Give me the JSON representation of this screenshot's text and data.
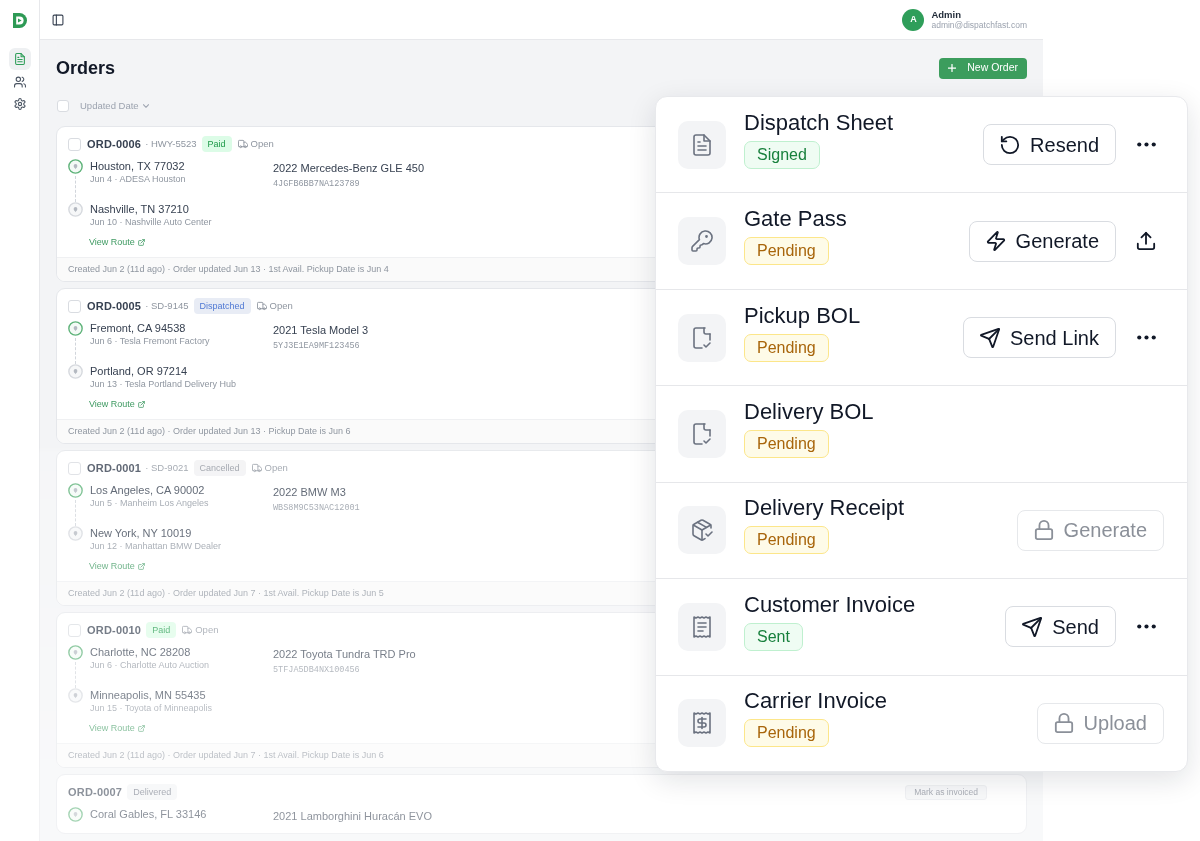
{
  "sidebar": {
    "nav": [
      {
        "kind": "orders",
        "selected": true
      },
      {
        "kind": "users",
        "selected": false
      },
      {
        "kind": "settings",
        "selected": false
      }
    ]
  },
  "header": {
    "user": {
      "initial": "A",
      "name": "Admin",
      "email": "admin@dispatchfast.com"
    }
  },
  "page": {
    "title": "Orders",
    "new_order_button": "New Order",
    "sort": {
      "checked": false,
      "label": "Updated Date"
    }
  },
  "orders": [
    {
      "number": "ORD-0006",
      "ref": "· HWY-5523",
      "checked": false,
      "status": {
        "label": "Paid",
        "kind": "paid"
      },
      "shipment": "Open",
      "stops": [
        {
          "kind": "pickup",
          "city": "Houston, TX 77032",
          "detail": "Jun 4 · ADESA Houston"
        },
        {
          "kind": "delivery",
          "city": "Nashville, TN 37210",
          "detail": "Jun 10 · Nashville Auto Center"
        }
      ],
      "vehicle": {
        "name": "2022 Mercedes-Benz GLE 450",
        "vin": "4JGFB6BB7NA123789"
      },
      "route_link": "View Route",
      "footer": "Created Jun 2 (11d ago) · Order updated Jun 13 · 1st Avail. Pickup Date is Jun 4"
    },
    {
      "number": "ORD-0005",
      "ref": "· SD-9145",
      "checked": false,
      "status": {
        "label": "Dispatched",
        "kind": "dispatched"
      },
      "shipment": "Open",
      "stops": [
        {
          "kind": "pickup",
          "city": "Fremont, CA 94538",
          "detail": "Jun 6 · Tesla Fremont Factory"
        },
        {
          "kind": "delivery",
          "city": "Portland, OR 97214",
          "detail": "Jun 13 · Tesla Portland Delivery Hub"
        }
      ],
      "vehicle": {
        "name": "2021 Tesla Model 3",
        "vin": "5YJ3E1EA9MF123456"
      },
      "route_link": "View Route",
      "footer": "Created Jun 2 (11d ago) · Order updated Jun 13 · Pickup Date is Jun 6"
    },
    {
      "number": "ORD-0001",
      "ref": "· SD-9021",
      "checked": false,
      "status": {
        "label": "Cancelled",
        "kind": "cancelled"
      },
      "shipment": "Open",
      "stops": [
        {
          "kind": "pickup",
          "city": "Los Angeles, CA 90002",
          "detail": "Jun 5 · Manheim Los Angeles"
        },
        {
          "kind": "delivery",
          "city": "New York, NY 10019",
          "detail": "Jun 12 · Manhattan BMW Dealer"
        }
      ],
      "vehicle": {
        "name": "2022 BMW M3",
        "vin": "WBS8M9C53NAC12001"
      },
      "route_link": "View Route",
      "footer": "Created Jun 2 (11d ago) · Order updated Jun 7 · 1st Avail. Pickup Date is Jun 5"
    },
    {
      "number": "ORD-0010",
      "checked": false,
      "status": {
        "label": "Paid",
        "kind": "paid"
      },
      "shipment": "Open",
      "stops": [
        {
          "kind": "pickup",
          "city": "Charlotte, NC 28208",
          "detail": "Jun 6 · Charlotte Auto Auction"
        },
        {
          "kind": "delivery",
          "city": "Minneapolis, MN 55435",
          "detail": "Jun 15 · Toyota of Minneapolis"
        }
      ],
      "vehicle": {
        "name": "2022 Toyota Tundra TRD Pro",
        "vin": "5TFJA5DB4NX100456"
      },
      "route_link": "View Route",
      "footer": "Created Jun 2 (11d ago) · Order updated Jun 7 · 1st Avail. Pickup Date is Jun 6"
    },
    {
      "number": "ORD-0007",
      "status": {
        "label": "Delivered",
        "kind": "delivered"
      },
      "action": "Mark as invoiced",
      "stops": [
        {
          "kind": "pickup",
          "city": "Coral Gables, FL 33146"
        }
      ],
      "vehicle": {
        "name": "2021 Lamborghini Huracán EVO"
      }
    }
  ],
  "documents": [
    {
      "kind": "sheet",
      "title": "Dispatch Sheet",
      "status": {
        "label": "Signed",
        "kind": "done"
      },
      "action": {
        "label": "Resend",
        "kind": "resend",
        "disabled": false
      },
      "more_menu": true,
      "upload_button": false
    },
    {
      "kind": "key",
      "title": "Gate Pass",
      "status": {
        "label": "Pending",
        "kind": "pending"
      },
      "action": {
        "label": "Generate",
        "kind": "generate",
        "disabled": false
      },
      "more_menu": false,
      "upload_button": true
    },
    {
      "kind": "bol",
      "title": "Pickup BOL",
      "status": {
        "label": "Pending",
        "kind": "pending"
      },
      "action": {
        "label": "Send Link",
        "kind": "send",
        "disabled": false
      },
      "more_menu": true,
      "upload_button": false
    },
    {
      "kind": "bol",
      "title": "Delivery BOL",
      "status": {
        "label": "Pending",
        "kind": "pending"
      },
      "more_menu": false,
      "upload_button": false
    },
    {
      "kind": "package",
      "title": "Delivery Receipt",
      "status": {
        "label": "Pending",
        "kind": "pending"
      },
      "action": {
        "label": "Generate",
        "disabled": true
      },
      "more_menu": false,
      "upload_button": false
    },
    {
      "kind": "receipt",
      "title": "Customer Invoice",
      "status": {
        "label": "Sent",
        "kind": "done"
      },
      "action": {
        "label": "Send",
        "kind": "send",
        "disabled": false
      },
      "more_menu": true,
      "upload_button": false
    },
    {
      "kind": "receipt-dollar",
      "title": "Carrier Invoice",
      "status": {
        "label": "Pending",
        "kind": "pending"
      },
      "action": {
        "label": "Upload",
        "disabled": true
      },
      "more_menu": false,
      "upload_button": false
    }
  ]
}
